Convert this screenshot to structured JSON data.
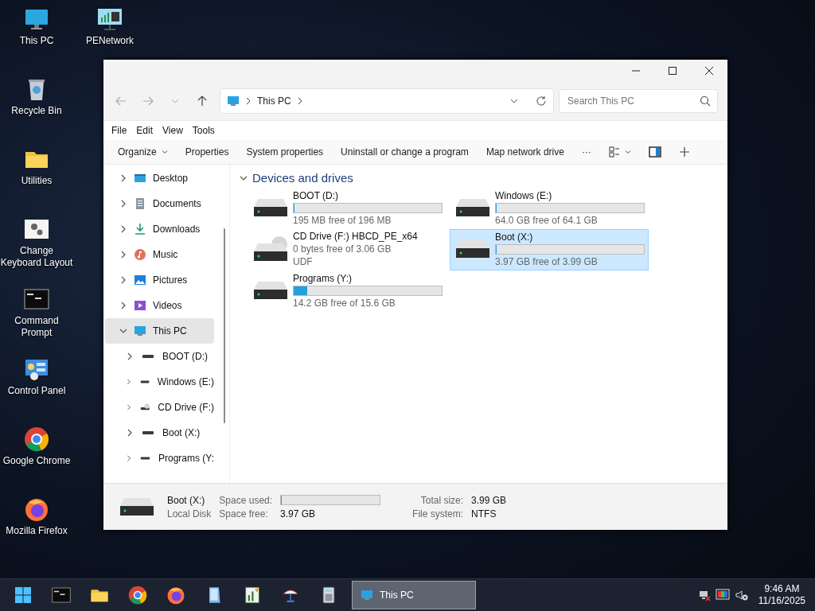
{
  "desktop_icons": [
    {
      "label": "This PC",
      "kind": "monitor"
    },
    {
      "label": "Recycle Bin",
      "kind": "recycle"
    },
    {
      "label": "Utilities",
      "kind": "folder"
    },
    {
      "label": "Change Keyboard Layout",
      "kind": "gears"
    },
    {
      "label": "Command Prompt",
      "kind": "terminal"
    },
    {
      "label": "Control Panel",
      "kind": "control"
    },
    {
      "label": "Google Chrome",
      "kind": "chrome"
    },
    {
      "label": "Mozilla Firefox",
      "kind": "firefox"
    },
    {
      "label": "PENetwork",
      "kind": "network"
    }
  ],
  "window": {
    "address": {
      "location": "This PC"
    },
    "search": {
      "placeholder": "Search This PC"
    },
    "menu": [
      "File",
      "Edit",
      "View",
      "Tools"
    ],
    "toolbar": [
      {
        "label": "Organize",
        "kind": "dropdown"
      },
      {
        "label": "Properties",
        "kind": "text"
      },
      {
        "label": "System properties",
        "kind": "text"
      },
      {
        "label": "Uninstall or change a program",
        "kind": "text"
      },
      {
        "label": "Map network drive",
        "kind": "text"
      },
      {
        "label": "···",
        "kind": "text"
      }
    ],
    "sidebar": {
      "items": [
        {
          "label": "Desktop",
          "kind": "desktop",
          "expanded": false,
          "selected": false
        },
        {
          "label": "Documents",
          "kind": "documents",
          "expanded": false,
          "selected": false
        },
        {
          "label": "Downloads",
          "kind": "downloads",
          "expanded": false,
          "selected": false
        },
        {
          "label": "Music",
          "kind": "music",
          "expanded": false,
          "selected": false
        },
        {
          "label": "Pictures",
          "kind": "pictures",
          "expanded": false,
          "selected": false
        },
        {
          "label": "Videos",
          "kind": "videos",
          "expanded": false,
          "selected": false
        },
        {
          "label": "This PC",
          "kind": "pc",
          "expanded": true,
          "selected": true,
          "children": [
            {
              "label": "BOOT (D:)",
              "kind": "disk",
              "expanded": false,
              "selected": false
            },
            {
              "label": "Windows (E:)",
              "kind": "disk",
              "expanded": false,
              "selected": false
            },
            {
              "label": "CD Drive (F:)",
              "kind": "cd",
              "expanded": false,
              "selected": false
            },
            {
              "label": "Boot (X:)",
              "kind": "disk",
              "expanded": false,
              "selected": false
            },
            {
              "label": "Programs (Y:",
              "kind": "disk",
              "expanded": false,
              "selected": false
            }
          ]
        }
      ]
    },
    "group": {
      "title": "Devices and drives",
      "expanded": true
    },
    "drives": [
      {
        "name": "BOOT (D:)",
        "kind": "disk",
        "level": 0.005,
        "free": "195 MB free of 196 MB",
        "selected": false
      },
      {
        "name": "Windows (E:)",
        "kind": "disk",
        "level": 0.003,
        "free": "64.0 GB free of 64.1 GB",
        "selected": false
      },
      {
        "name": "CD Drive (F:) HBCD_PE_x64",
        "kind": "cd",
        "free": "0 bytes free of 3.06 GB",
        "filesystem": "UDF",
        "selected": false
      },
      {
        "name": "Boot (X:)",
        "kind": "disk",
        "level": 0.005,
        "free": "3.97 GB free of 3.99 GB",
        "selected": true
      },
      {
        "name": "Programs (Y:)",
        "kind": "disk",
        "level": 0.09,
        "free": "14.2 GB free of 15.6 GB",
        "selected": false
      }
    ],
    "details": {
      "name": "Boot (X:)",
      "type": "Local Disk",
      "used_label": "Space used:",
      "level": 0.005,
      "free_label": "Space free:",
      "free_value": "3.97 GB",
      "total_label": "Total size:",
      "total_value": "3.99 GB",
      "fs_label": "File system:",
      "fs_value": "NTFS"
    }
  },
  "taskbar": {
    "apps": [
      {
        "kind": "terminal"
      },
      {
        "kind": "folder"
      },
      {
        "kind": "chrome"
      },
      {
        "kind": "firefox"
      },
      {
        "kind": "notepad"
      },
      {
        "kind": "chart"
      },
      {
        "kind": "satellite"
      },
      {
        "kind": "calculator"
      }
    ],
    "window_button": {
      "label": "This PC",
      "selected": true
    },
    "time": "9:46 AM",
    "date": "11/16/2025"
  }
}
